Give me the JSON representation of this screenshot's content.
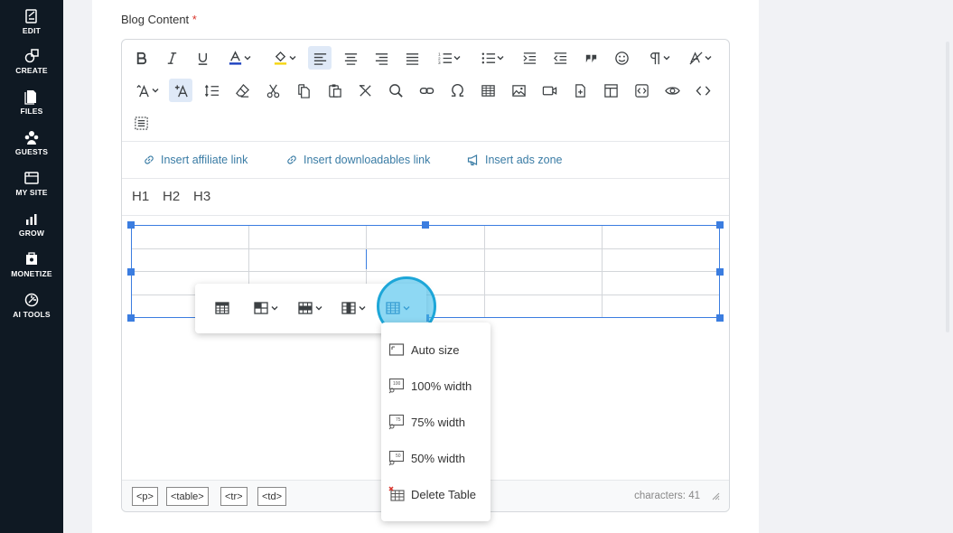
{
  "sidebar": {
    "items": [
      {
        "label": "EDIT",
        "icon": "edit-icon"
      },
      {
        "label": "CREATE",
        "icon": "create-icon"
      },
      {
        "label": "FILES",
        "icon": "files-icon"
      },
      {
        "label": "GUESTS",
        "icon": "guests-icon"
      },
      {
        "label": "MY SITE",
        "icon": "site-icon"
      },
      {
        "label": "GROW",
        "icon": "grow-icon"
      },
      {
        "label": "MONETIZE",
        "icon": "monetize-icon"
      },
      {
        "label": "AI TOOLS",
        "icon": "ai-tools-icon"
      }
    ]
  },
  "field": {
    "label": "Blog Content",
    "required_mark": "*"
  },
  "plugins": {
    "affiliate": "Insert affiliate link",
    "downloadables": "Insert downloadables link",
    "ads": "Insert ads zone"
  },
  "headings": [
    "H1",
    "H2",
    "H3"
  ],
  "table": {
    "rows": 4,
    "cols": 5
  },
  "statusbar": {
    "path": [
      "<p>",
      "<table>",
      "<tr>",
      "<td>"
    ],
    "char_label": "characters: 41"
  },
  "table_menu": {
    "items": [
      "Auto size",
      "100% width",
      "75% width",
      "50% width",
      "Delete Table"
    ]
  },
  "colors": {
    "sidebar_bg": "#0f1923",
    "accent": "#3b7de0",
    "link": "#3a7ca5",
    "highlight": "#1da6d8",
    "font_color_bar": "#1a3fbf",
    "highlight_color_bar": "#f5d40f"
  }
}
